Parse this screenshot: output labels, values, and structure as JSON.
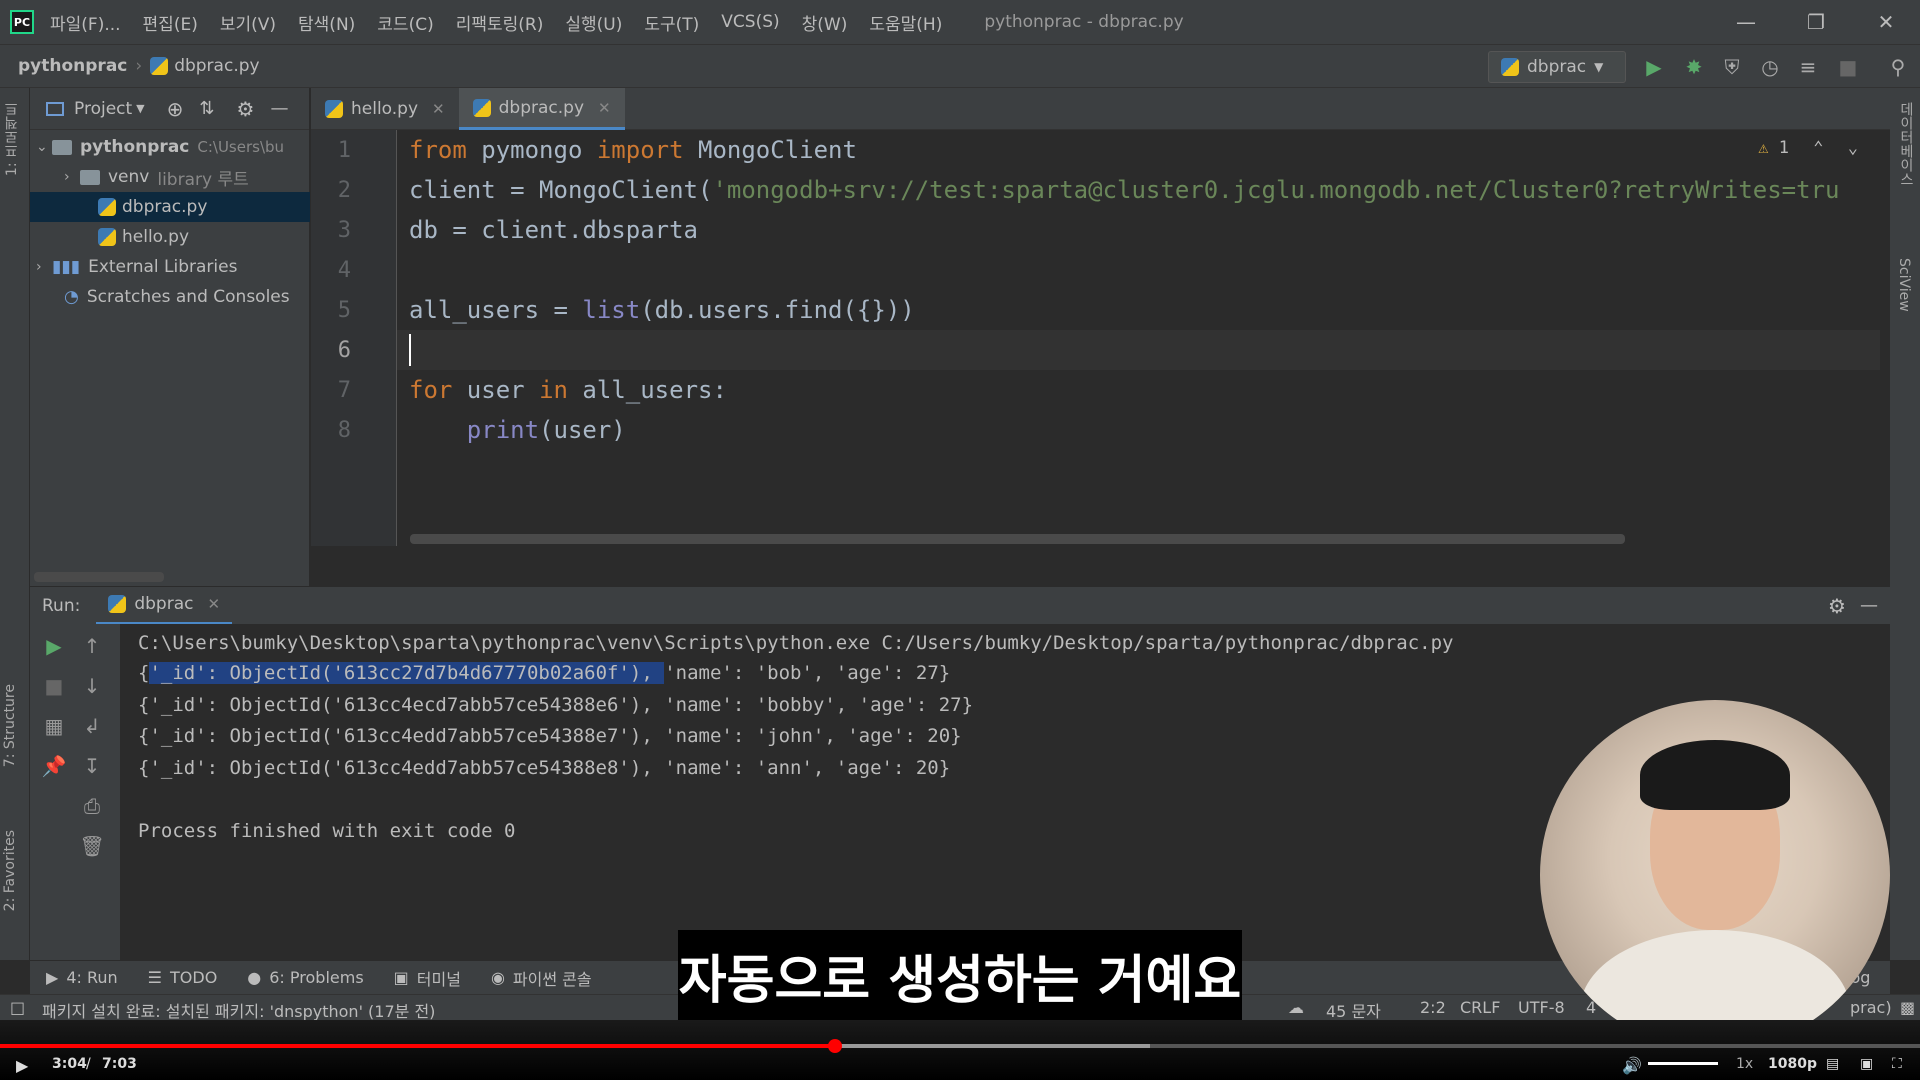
{
  "window": {
    "menu": [
      "파일(F)...",
      "편집(E)",
      "보기(V)",
      "탐색(N)",
      "코드(C)",
      "리팩토링(R)",
      "실행(U)",
      "도구(T)",
      "VCS(S)",
      "창(W)",
      "도움말(H)"
    ],
    "title": "pythonprac - dbprac.py"
  },
  "nav": {
    "project": "pythonprac",
    "file": "dbprac.py",
    "run_config": "dbprac"
  },
  "left_tabs": {
    "project": "1: 프로젝트",
    "structure": "7: Structure",
    "favorites": "2: Favorites"
  },
  "right_tabs": {
    "db": "데이터베이스",
    "sciview": "SciView"
  },
  "project_panel": {
    "title": "Project",
    "root": "pythonprac",
    "root_path": "C:\\Users\\bu",
    "venv": "venv",
    "venv_note": "library 루트",
    "files": [
      "dbprac.py",
      "hello.py"
    ],
    "external": "External Libraries",
    "scratches": "Scratches and Consoles"
  },
  "editor": {
    "tabs": [
      "hello.py",
      "dbprac.py"
    ],
    "active_tab": "dbprac.py",
    "line_numbers": [
      "1",
      "2",
      "3",
      "4",
      "5",
      "6",
      "7",
      "8"
    ],
    "warning_count": "1",
    "lines": {
      "l1": {
        "kw1": "from",
        "t1": " pymongo ",
        "kw2": "import",
        "t2": " MongoClient"
      },
      "l2": {
        "t1": "client = MongoClient(",
        "str": "'mongodb+srv://test:sparta@cluster0.jcglu.mongodb.net/Cluster0?retryWrites=tru"
      },
      "l3": {
        "t1": "db = client.dbsparta"
      },
      "l5": {
        "t1": "all_users = ",
        "bi": "list",
        "t2": "(db.users.find({}))"
      },
      "l7": {
        "kw1": "for",
        "t1": " user ",
        "kw2": "in",
        "t2": " all_users:"
      },
      "l8": {
        "indent": "    ",
        "bi": "print",
        "t1": "(user)"
      }
    }
  },
  "run_panel": {
    "label": "Run:",
    "tab": "dbprac",
    "command": "C:\\Users\\bumky\\Desktop\\sparta\\pythonprac\\venv\\Scripts\\python.exe C:/Users/bumky/Desktop/sparta/pythonprac/dbprac.py",
    "output": [
      {
        "pre": "{",
        "sel": "'_id': ObjectId('613cc27d7b4d67770b02a60f'), ",
        "post": "'name': 'bob', 'age': 27}"
      },
      {
        "pre": "{'_id': ObjectId('613cc4ecd7abb57ce54388e6'), 'name': 'bobby', 'age': 27}",
        "sel": "",
        "post": ""
      },
      {
        "pre": "{'_id': ObjectId('613cc4edd7abb57ce54388e7'), 'name': 'john', 'age': 20}",
        "sel": "",
        "post": ""
      },
      {
        "pre": "{'_id': ObjectId('613cc4edd7abb57ce54388e8'), 'name': 'ann', 'age': 20}",
        "sel": "",
        "post": ""
      }
    ],
    "finished": "Process finished with exit code 0"
  },
  "tool_tabs": [
    "4: Run",
    "TODO",
    "6: Problems",
    "터미널",
    "파이썬 콘솔"
  ],
  "status": {
    "message": "패키지 설치 완료: 설치된 패키지: 'dnspython' (17분 전)",
    "chars": "45 문자",
    "position": "2:2",
    "line_sep": "CRLF",
    "encoding": "UTF-8",
    "indent": "4",
    "event_log": "log",
    "interpreter": "prac)"
  },
  "subtitle": "자동으로 생성하는 거예요",
  "video": {
    "current": "3:04",
    "sep": "/",
    "total": "7:03",
    "speed": "1x",
    "quality": "1080p",
    "progress": 0.435
  }
}
